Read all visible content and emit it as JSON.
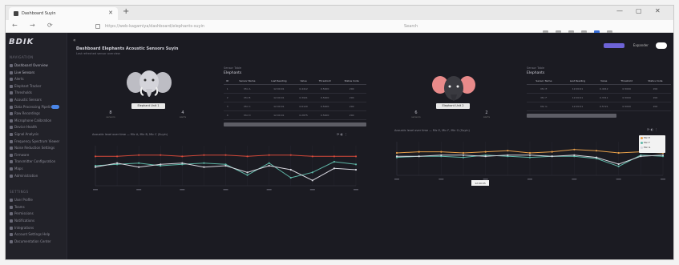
{
  "browser": {
    "tab_title": "Dashboard Suyin",
    "tab_close": "✕",
    "new_tab": "+",
    "url": "https://web-kagamiya/dashboard/elephants-suyin",
    "search_placeholder": "Search",
    "nav_back": "←",
    "nav_forward": "→",
    "nav_reload": "⟳",
    "win_min": "—",
    "win_max": "▢",
    "win_close": "✕"
  },
  "app": {
    "logo": "BDIK",
    "collapse": "«",
    "top_label": "Expander",
    "page_title": "Dashboard Elephants Acoustic Sensors Suyin",
    "page_subtitle": "Last refreshed sensor overview"
  },
  "sidebar": {
    "section_top": "NAVIGATION",
    "items": [
      {
        "label": "Dashboard Overview"
      },
      {
        "label": "Live Sensors"
      },
      {
        "label": "Alerts"
      },
      {
        "label": "Elephant Tracker"
      },
      {
        "label": "Thresholds"
      },
      {
        "label": "Acoustic Sensors"
      },
      {
        "label": "Data Processing Pipeline"
      },
      {
        "label": "Raw Recordings"
      },
      {
        "label": "Microphone Calibration"
      },
      {
        "label": "Device Health"
      },
      {
        "label": "Signal Analysis"
      },
      {
        "label": "Frequency Spectrum Viewer"
      },
      {
        "label": "Noise Reduction Settings"
      },
      {
        "label": "Firmware"
      },
      {
        "label": "Transmitter Configuration"
      },
      {
        "label": "Maps"
      },
      {
        "label": "Administration"
      }
    ],
    "section_bottom": "SETTINGS",
    "bottom_items": [
      {
        "label": "User Profile"
      },
      {
        "label": "Teams"
      },
      {
        "label": "Permissions"
      },
      {
        "label": "Notifications"
      },
      {
        "label": "Integrations"
      },
      {
        "label": "Account Settings Help"
      },
      {
        "label": "Documentation Center"
      }
    ]
  },
  "left_panel": {
    "badge": "Elephant Unit 1",
    "stat_left": "8",
    "stat_left_sub": "sensors",
    "stat_right": "4",
    "stat_right_sub": "alerts",
    "table_caption": "Sensor Table",
    "table_title": "Elephants",
    "headers": [
      "ID",
      "Sensor Name",
      "Last Reading",
      "Value",
      "Threshold",
      "Status Code"
    ],
    "rows": [
      [
        "1",
        "Mic A",
        "12:00:01",
        "0.4412",
        "0.5000",
        "200"
      ],
      [
        "2",
        "Mic B",
        "12:00:01",
        "0.3921",
        "0.5000",
        "200"
      ],
      [
        "3",
        "Mic C",
        "12:00:01",
        "0.6120",
        "0.5000",
        "200"
      ],
      [
        "4",
        "Mic D",
        "12:00:01",
        "0.2875",
        "0.5000",
        "200"
      ]
    ],
    "chart_title": "Acoustic level over time — Mic A, Mic B, Mic C (Suyin)",
    "chart_ctrl": "⟳ ◐ ⋮"
  },
  "right_panel": {
    "badge": "Elephant Unit 2",
    "stat_left": "6",
    "stat_left_sub": "sensors",
    "stat_right": "2",
    "stat_right_sub": "alerts",
    "table_caption": "Sensor Table",
    "table_title": "Elephants",
    "headers": [
      "Sensor Name",
      "Last Reading",
      "Value",
      "Threshold",
      "Status Code"
    ],
    "rows": [
      [
        "Mic E",
        "12:00:01",
        "0.4012",
        "0.5000",
        "200"
      ],
      [
        "Mic F",
        "12:00:01",
        "0.3311",
        "0.5000",
        "200"
      ],
      [
        "Mic G",
        "12:00:01",
        "0.5721",
        "0.5000",
        "200"
      ]
    ],
    "chart_title": "Acoustic level over time — Mic E, Mic F, Mic G (Suyin)",
    "chart_ctrl": "⟳ ◐ ⋮",
    "tooltip": "12:00:05",
    "legend": [
      {
        "name": "Mic E",
        "color": "#e8a04a"
      },
      {
        "name": "Mic F",
        "color": "#5fb8a8"
      },
      {
        "name": "Mic G",
        "color": "#d8d8e0"
      }
    ]
  },
  "colors": {
    "accent": "#6d63d6",
    "background": "#1b1b22",
    "sidebar": "#222229",
    "red_line": "#d84a3a",
    "teal_line": "#5fb8a8",
    "white_line": "#d8d8e0",
    "orange_line": "#e8a04a",
    "blue_line": "#4a86e8"
  },
  "chart_data": [
    {
      "type": "line",
      "x": [
        "0",
        "1",
        "2",
        "3",
        "4",
        "5",
        "6",
        "7",
        "8",
        "9",
        "10",
        "11",
        "12"
      ],
      "series": [
        {
          "values": [
            0.52,
            0.52,
            0.53,
            0.53,
            0.52,
            0.53,
            0.53,
            0.52,
            0.53,
            0.53,
            0.52,
            0.52,
            0.52
          ],
          "color": "#d84a3a"
        },
        {
          "values": [
            0.45,
            0.46,
            0.47,
            0.45,
            0.46,
            0.47,
            0.46,
            0.38,
            0.47,
            0.36,
            0.4,
            0.48,
            0.46
          ],
          "color": "#5fb8a8"
        },
        {
          "values": [
            0.44,
            0.47,
            0.44,
            0.46,
            0.47,
            0.44,
            0.45,
            0.4,
            0.45,
            0.42,
            0.34,
            0.43,
            0.42
          ],
          "color": "#d8d8e0"
        }
      ],
      "ylim": [
        0,
        1
      ]
    },
    {
      "type": "line",
      "x": [
        "0",
        "1",
        "2",
        "3",
        "4",
        "5",
        "6",
        "7",
        "8",
        "9",
        "10",
        "11",
        "12"
      ],
      "series": [
        {
          "name": "Mic E",
          "values": [
            0.5,
            0.51,
            0.51,
            0.5,
            0.51,
            0.52,
            0.5,
            0.51,
            0.53,
            0.52,
            0.5,
            0.51,
            0.5
          ],
          "color": "#e8a04a"
        },
        {
          "name": "Mic F",
          "values": [
            0.46,
            0.47,
            0.47,
            0.46,
            0.48,
            0.47,
            0.46,
            0.47,
            0.47,
            0.45,
            0.38,
            0.48,
            0.47
          ],
          "color": "#5fb8a8"
        },
        {
          "name": "Mic G",
          "values": [
            0.47,
            0.47,
            0.48,
            0.48,
            0.47,
            0.48,
            0.48,
            0.47,
            0.48,
            0.46,
            0.4,
            0.47,
            0.48
          ],
          "color": "#d8d8e0"
        }
      ],
      "ylim": [
        0,
        1
      ]
    }
  ]
}
